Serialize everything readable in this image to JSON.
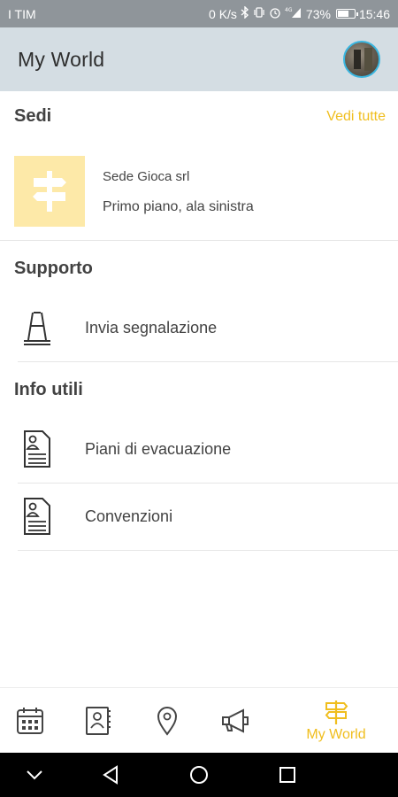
{
  "status_bar": {
    "carrier": "I TIM",
    "net_speed": "0 K/s",
    "signal": "4G",
    "battery": "73%",
    "time": "15:46",
    "battery_level": 0.73
  },
  "header": {
    "title": "My World"
  },
  "sedi": {
    "heading": "Sedi",
    "see_all": "Vedi tutte",
    "items": [
      {
        "name": "Sede Gioca srl",
        "detail": "Primo piano, ala sinistra",
        "icon": "signpost-icon"
      }
    ]
  },
  "supporto": {
    "heading": "Supporto",
    "items": [
      {
        "label": "Invia segnalazione",
        "icon": "traffic-cone-icon"
      }
    ]
  },
  "info": {
    "heading": "Info utili",
    "items": [
      {
        "label": "Piani di evacuazione",
        "icon": "document-person-icon"
      },
      {
        "label": "Convenzioni",
        "icon": "document-person-icon"
      }
    ]
  },
  "bottom_nav": {
    "items": [
      {
        "icon": "calendar-icon",
        "label": ""
      },
      {
        "icon": "contacts-book-icon",
        "label": ""
      },
      {
        "icon": "location-pin-icon",
        "label": ""
      },
      {
        "icon": "megaphone-icon",
        "label": ""
      },
      {
        "icon": "signpost-icon",
        "label": "My World",
        "active": true
      }
    ]
  },
  "colors": {
    "accent": "#f0be1e",
    "header_bg": "#d4dde3",
    "sede_tile": "#fde9a8",
    "avatar_ring": "#3ab6e0"
  }
}
